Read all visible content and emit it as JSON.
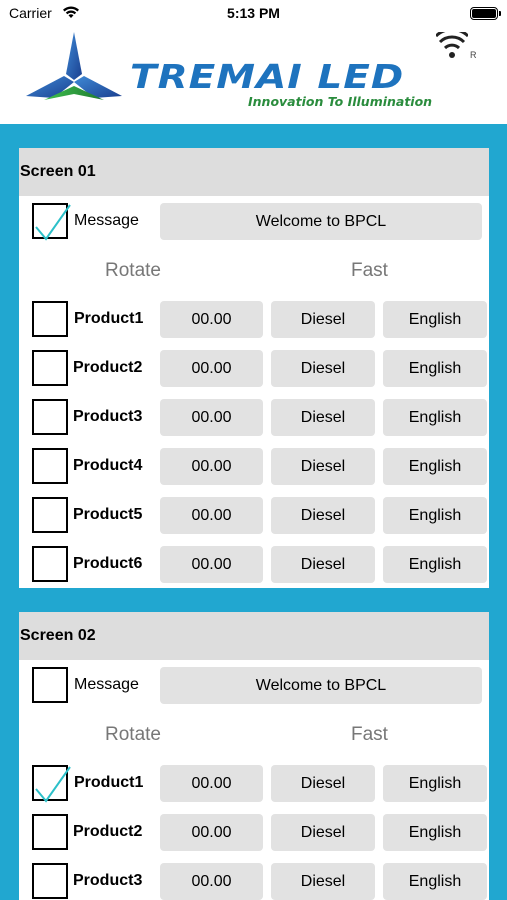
{
  "status": {
    "carrier": "Carrier",
    "time": "5:13 PM"
  },
  "brand": {
    "name": "TREMAI LED",
    "tagline": "Innovation To Illumination",
    "registered": "R",
    "colors": {
      "blue": "#1e73be",
      "green": "#2a8c3d",
      "accent": "#21a7d0"
    }
  },
  "screens": [
    {
      "title": "Screen 01",
      "message": {
        "label": "Message",
        "checked": true,
        "value": "Welcome to BPCL"
      },
      "rotate_label": "Rotate",
      "fast_label": "Fast",
      "products": [
        {
          "label": "Product1",
          "checked": false,
          "price": "00.00",
          "fuel": "Diesel",
          "language": "English"
        },
        {
          "label": "Product2",
          "checked": false,
          "price": "00.00",
          "fuel": "Diesel",
          "language": "English"
        },
        {
          "label": "Product3",
          "checked": false,
          "price": "00.00",
          "fuel": "Diesel",
          "language": "English"
        },
        {
          "label": "Product4",
          "checked": false,
          "price": "00.00",
          "fuel": "Diesel",
          "language": "English"
        },
        {
          "label": "Product5",
          "checked": false,
          "price": "00.00",
          "fuel": "Diesel",
          "language": "English"
        },
        {
          "label": "Product6",
          "checked": false,
          "price": "00.00",
          "fuel": "Diesel",
          "language": "English"
        }
      ]
    },
    {
      "title": "Screen 02",
      "message": {
        "label": "Message",
        "checked": false,
        "value": "Welcome to BPCL"
      },
      "rotate_label": "Rotate",
      "fast_label": "Fast",
      "products": [
        {
          "label": "Product1",
          "checked": true,
          "price": "00.00",
          "fuel": "Diesel",
          "language": "English"
        },
        {
          "label": "Product2",
          "checked": false,
          "price": "00.00",
          "fuel": "Diesel",
          "language": "English"
        },
        {
          "label": "Product3",
          "checked": false,
          "price": "00.00",
          "fuel": "Diesel",
          "language": "English"
        }
      ]
    }
  ]
}
